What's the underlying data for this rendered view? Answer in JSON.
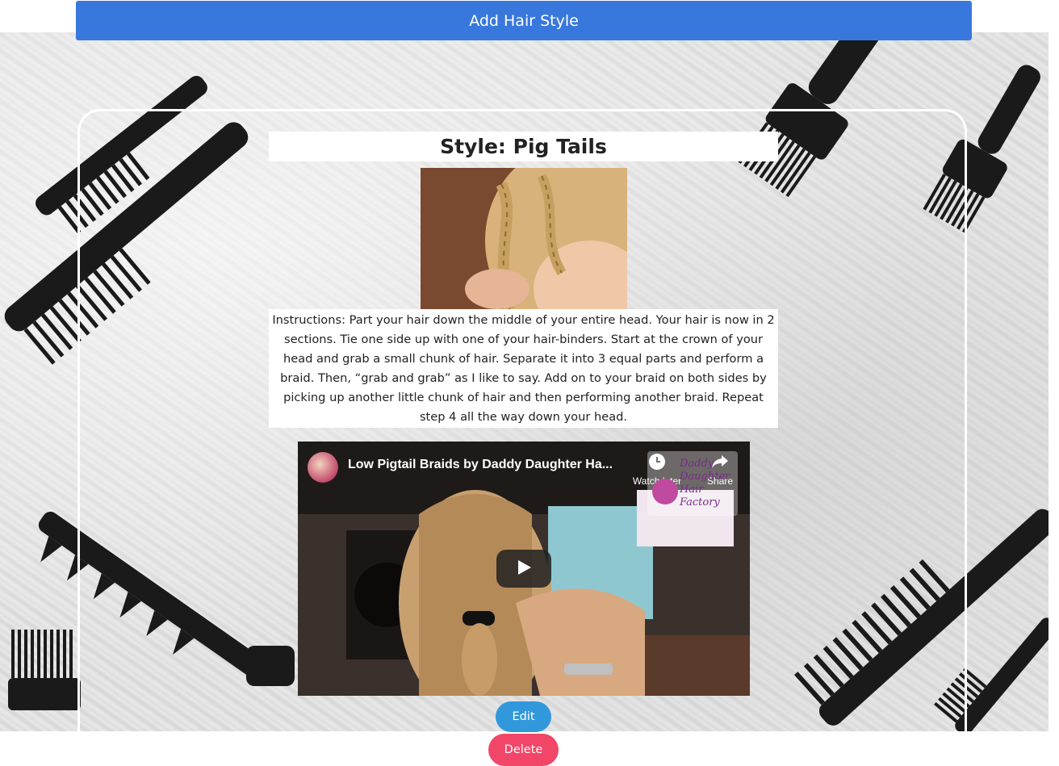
{
  "header": {
    "add_button_label": "Add Hair Style"
  },
  "style": {
    "title": "Style: Pig Tails",
    "instructions": "Instructions: Part your hair down the middle of your entire head. Your hair is now in 2 sections. Tie one side up with one of your hair-binders. Start at the crown of your head and grab a small chunk of hair. Separate it into 3 equal parts and perform a braid. Then, “grab and grab” as I like to say. Add on to your braid on both sides by picking up another little chunk of hair and then performing another braid. Repeat step 4 all the way down your head."
  },
  "video": {
    "title": "Low Pigtail Braids by Daddy Daughter Ha...",
    "watch_later_label": "Watch later",
    "share_label": "Share",
    "channel_logo_text": "Daddy Daughter Hair Factory"
  },
  "actions": {
    "edit_label": "Edit",
    "delete_label": "Delete"
  },
  "colors": {
    "primary": "#3878dd",
    "info": "#3298dc",
    "danger": "#f14668"
  }
}
